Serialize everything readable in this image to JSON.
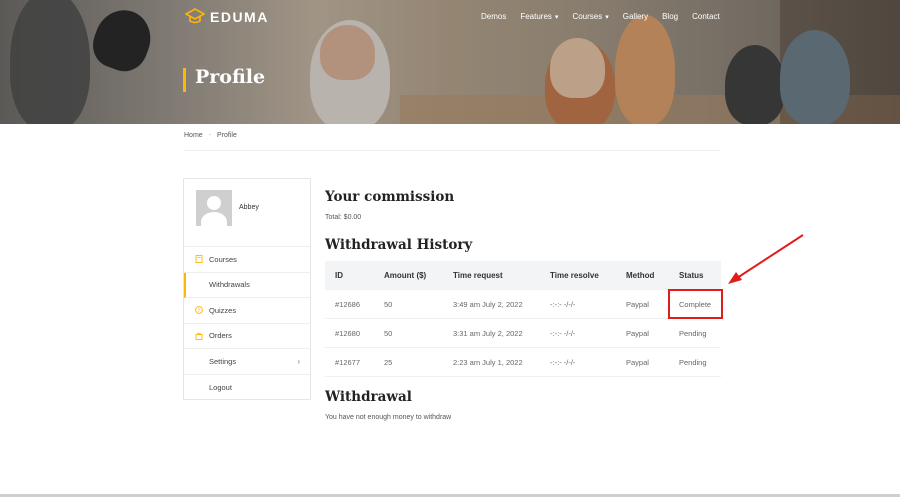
{
  "brand": {
    "name": "EDUMA",
    "accent_color": "#ffb606"
  },
  "nav": [
    {
      "label": "Demos",
      "dropdown": false
    },
    {
      "label": "Features",
      "dropdown": true
    },
    {
      "label": "Courses",
      "dropdown": true
    },
    {
      "label": "Gallery",
      "dropdown": false
    },
    {
      "label": "Blog",
      "dropdown": false
    },
    {
      "label": "Contact",
      "dropdown": false
    }
  ],
  "page_title": "Profile",
  "breadcrumb": {
    "home": "Home",
    "current": "Profile"
  },
  "profile": {
    "username": "Abbey"
  },
  "sidebar": [
    {
      "label": "Courses",
      "icon": "courses-icon"
    },
    {
      "label": "Withdrawals",
      "icon": "",
      "active": true
    },
    {
      "label": "Quizzes",
      "icon": "quizzes-icon"
    },
    {
      "label": "Orders",
      "icon": "orders-icon"
    },
    {
      "label": "Settings",
      "icon": "",
      "has_submenu": true
    },
    {
      "label": "Logout",
      "icon": ""
    }
  ],
  "commission": {
    "heading": "Your commission",
    "total": "Total: $0.00"
  },
  "history": {
    "heading": "Withdrawal History",
    "columns": [
      "ID",
      "Amount ($)",
      "Time request",
      "Time resolve",
      "Method",
      "Status"
    ],
    "rows": [
      [
        "#12686",
        "50",
        "3:49 am July 2, 2022",
        "-:-:- -/-/-",
        "Paypal",
        "Complete"
      ],
      [
        "#12680",
        "50",
        "3:31 am July 2, 2022",
        "-:-:- -/-/-",
        "Paypal",
        "Pending"
      ],
      [
        "#12677",
        "25",
        "2:23 am July 1, 2022",
        "-:-:- -/-/-",
        "Paypal",
        "Pending"
      ]
    ]
  },
  "withdrawal": {
    "heading": "Withdrawal",
    "message": "You have not enough money to withdraw"
  },
  "annotation": {
    "color": "#e21b1b"
  }
}
